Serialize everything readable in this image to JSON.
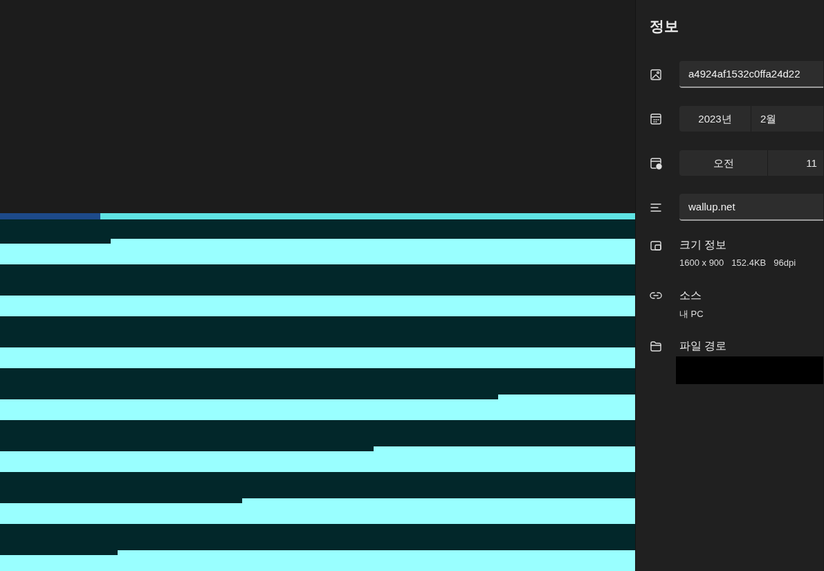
{
  "panel": {
    "title": "정보"
  },
  "fields": [
    {
      "kind": "name",
      "value": "a4924af1532c0ffa24d22"
    },
    {
      "kind": "date",
      "segments": [
        "2023년",
        "2월"
      ]
    },
    {
      "kind": "time",
      "segments": [
        "오전",
        "11"
      ]
    },
    {
      "kind": "caption",
      "value": "wallup.net"
    }
  ],
  "sections": [
    {
      "kind": "size",
      "label": "크기 정보",
      "details": [
        "1600 x 900",
        "152.4KB",
        "96dpi"
      ]
    },
    {
      "kind": "source",
      "label": "소스",
      "details": [
        "내 PC"
      ]
    },
    {
      "kind": "path",
      "label": "파일 경로",
      "redacted": true
    }
  ]
}
